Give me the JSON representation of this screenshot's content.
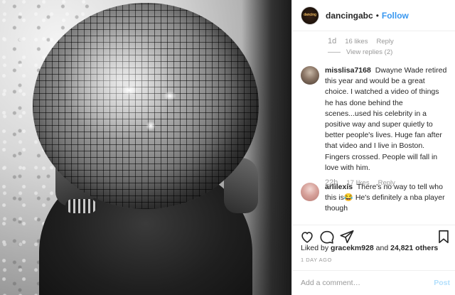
{
  "post": {
    "image_description_icon": "disco-ball-photo",
    "header": {
      "username": "dancingabc",
      "separator": "•",
      "follow_label": "Follow",
      "avatar_icon": "dancing-with-the-stars-logo",
      "avatar_text": "dancing"
    },
    "comments": [
      {
        "time": "1d",
        "likes": "16 likes",
        "reply_label": "Reply",
        "view_replies": "View replies (2)"
      },
      {
        "username": "misslisa7168",
        "text": "Dwayne Wade retired this year and would be a great choice. I watched a video of things he has done behind the scenes...used his celebrity in a positive way and super quietly to better people's lives. Huge fan after that video and I live in Boston. Fingers crossed. People will fall in love with him.",
        "time": "22h",
        "likes": "17 likes",
        "reply_label": "Reply"
      },
      {
        "username": "arlilexis",
        "text": "There's no way to tell who this is😂 He's definitely a nba player though"
      }
    ],
    "actions": {
      "like_icon": "heart-icon",
      "comment_icon": "comment-icon",
      "share_icon": "share-icon",
      "save_icon": "bookmark-icon"
    },
    "liked_by": {
      "prefix": "Liked by",
      "user": "gracekm928",
      "middle": "and",
      "count": "24,821 others"
    },
    "date": "1 DAY AGO",
    "add_comment": {
      "placeholder": "Add a comment…",
      "post_label": "Post"
    },
    "colors": {
      "accent": "#3897f0",
      "post_disabled": "#b2dffc",
      "muted": "#999999",
      "text": "#262626"
    }
  }
}
